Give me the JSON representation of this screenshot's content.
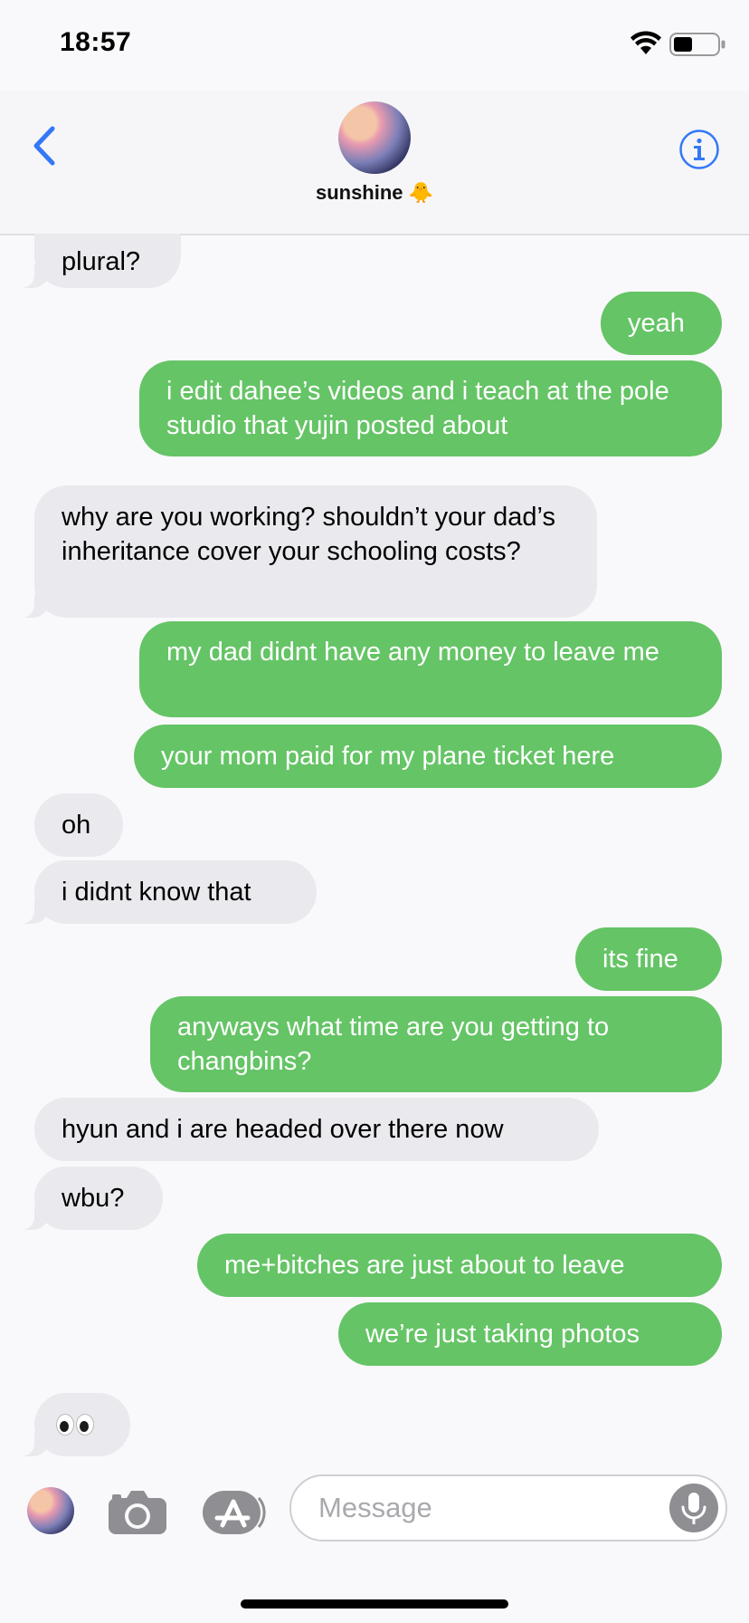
{
  "status_bar": {
    "time": "18:57"
  },
  "header": {
    "contact_name": "sunshine 🐥"
  },
  "messages": [
    {
      "dir": "in",
      "text": "plural?"
    },
    {
      "dir": "out",
      "text": "yeah"
    },
    {
      "dir": "out",
      "text": "i edit dahee’s videos and i teach at the pole studio that yujin posted about"
    },
    {
      "dir": "in",
      "text": "why are you working? shouldn’t your dad’s inheritance cover your schooling costs?"
    },
    {
      "dir": "out",
      "text": "my dad didnt have any money to leave me"
    },
    {
      "dir": "out",
      "text": "your mom paid for my plane ticket here"
    },
    {
      "dir": "in",
      "text": "oh"
    },
    {
      "dir": "in",
      "text": "i didnt know that"
    },
    {
      "dir": "out",
      "text": "its fine"
    },
    {
      "dir": "out",
      "text": "anyways what time are you getting to changbins?"
    },
    {
      "dir": "in",
      "text": "hyun and i are headed over there now"
    },
    {
      "dir": "in",
      "text": "wbu?"
    },
    {
      "dir": "out",
      "text": "me+bitches are just about to leave"
    },
    {
      "dir": "out",
      "text": "we’re just taking photos"
    },
    {
      "dir": "in",
      "text": "👀",
      "emoji": "eyes"
    }
  ],
  "input_bar": {
    "placeholder": "Message"
  },
  "colors": {
    "accent": "#3478f6",
    "outgoing": "#65c466",
    "incoming": "#e9e9ee"
  }
}
